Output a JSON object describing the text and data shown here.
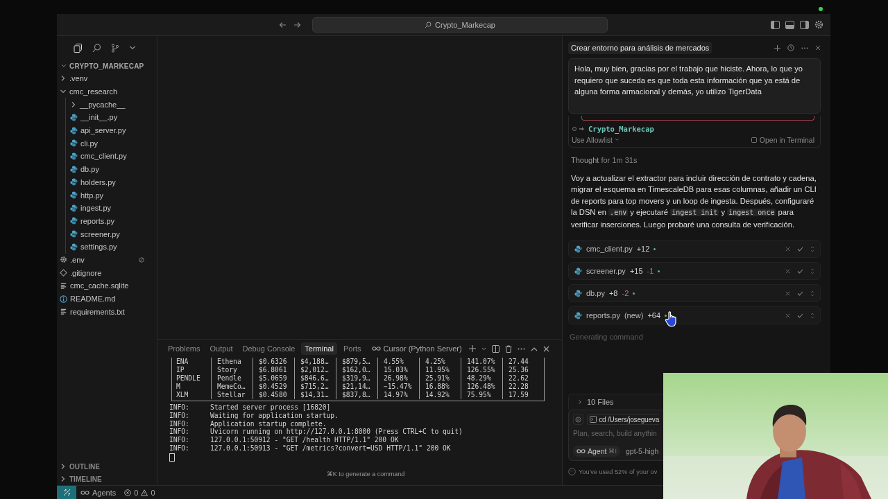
{
  "title_bar": {
    "search": "Crypto_Markecap"
  },
  "sidebar": {
    "project": "CRYPTO_MARKECAP",
    "tree": [
      {
        "name": ".venv",
        "kind": "folder",
        "expanded": false
      },
      {
        "name": "cmc_research",
        "kind": "folder",
        "expanded": true,
        "children": [
          {
            "name": "__pycache__",
            "kind": "folder",
            "expanded": false
          },
          {
            "name": "__init__.py",
            "kind": "python"
          },
          {
            "name": "api_server.py",
            "kind": "python"
          },
          {
            "name": "cli.py",
            "kind": "python"
          },
          {
            "name": "cmc_client.py",
            "kind": "python"
          },
          {
            "name": "db.py",
            "kind": "python"
          },
          {
            "name": "holders.py",
            "kind": "python"
          },
          {
            "name": "http.py",
            "kind": "python"
          },
          {
            "name": "ingest.py",
            "kind": "python"
          },
          {
            "name": "reports.py",
            "kind": "python"
          },
          {
            "name": "screener.py",
            "kind": "python"
          },
          {
            "name": "settings.py",
            "kind": "python"
          }
        ]
      },
      {
        "name": ".env",
        "kind": "settings",
        "ignored": true
      },
      {
        "name": ".gitignore",
        "kind": "git",
        "ignored": false
      },
      {
        "name": "cmc_cache.sqlite",
        "kind": "text",
        "ignored": false
      },
      {
        "name": "README.md",
        "kind": "info",
        "ignored": false
      },
      {
        "name": "requirements.txt",
        "kind": "text",
        "ignored": false
      }
    ],
    "sections": [
      {
        "label": "OUTLINE",
        "expanded": false
      },
      {
        "label": "TIMELINE",
        "expanded": false
      }
    ]
  },
  "panel": {
    "tabs": [
      {
        "label": "Problems",
        "selected": false
      },
      {
        "label": "Output",
        "selected": false
      },
      {
        "label": "Debug Console",
        "selected": false
      },
      {
        "label": "Terminal",
        "selected": true
      },
      {
        "label": "Ports",
        "selected": false
      }
    ],
    "terminal_name": "Cursor (Python Server)",
    "table_rows": [
      [
        "ENA",
        "Ethena",
        "$0.6326",
        "$4,188…",
        "$879,5…",
        "4.55%",
        "4.25%",
        "141.07%",
        "27.44"
      ],
      [
        "IP",
        "Story",
        "$6.8061",
        "$2,012…",
        "$162,0…",
        "15.03%",
        "11.95%",
        "126.55%",
        "25.36"
      ],
      [
        "PENDLE",
        "Pendle",
        "$5.0659",
        "$846,6…",
        "$319,9…",
        "26.98%",
        "25.91%",
        "48.29%",
        "22.62"
      ],
      [
        "M",
        "MemeCo…",
        "$0.4529",
        "$715,2…",
        "$21,14…",
        "−15.47%",
        "16.88%",
        "126.48%",
        "22.28"
      ],
      [
        "XLM",
        "Stellar",
        "$0.4580",
        "$14,31…",
        "$837,8…",
        "14.97%",
        "14.92%",
        "75.95%",
        "17.59"
      ]
    ],
    "log": [
      {
        "level": "INFO:",
        "message": "Started server process [16820]"
      },
      {
        "level": "INFO:",
        "message": "Waiting for application startup."
      },
      {
        "level": "INFO:",
        "message": "Application startup complete."
      },
      {
        "level": "INFO:",
        "message": "Uvicorn running on http://127.0.0.1:8000 (Press CTRL+C to quit)"
      },
      {
        "level": "INFO:",
        "message": "127.0.0.1:50912 - \"GET /health HTTP/1.1\" 200 OK"
      },
      {
        "level": "INFO:",
        "message": "127.0.0.1:50913 - \"GET /metrics?convert=USD HTTP/1.1\" 200 OK"
      }
    ],
    "hint": "⌘K to generate a command"
  },
  "chat": {
    "title": "Crear entorno para análisis de mercados",
    "user_message": "Hola, muy bien, gracias por el trabajo que hiciste. Ahora, lo que yo requiero que suceda es que toda esta información que ya está de alguna forma armacional y demás, yo utilizo TigerData",
    "command": {
      "path": "Crypto_Markecap",
      "allowlist": "Use Allowlist",
      "open": "Open in Terminal"
    },
    "thought": {
      "label": "Thought",
      "duration": "for 1m 31s"
    },
    "reply": [
      {
        "kind": "text",
        "text": "Voy a actualizar el extractor para incluir dirección de contrato y cadena, migrar el esquema en TimescaleDB para esas columnas, añadir un CLI de reports para top movers y un loop de ingesta. Después, configuraré la DSN en "
      },
      {
        "kind": "code",
        "text": ".env"
      },
      {
        "kind": "text",
        "text": " y ejecutaré "
      },
      {
        "kind": "code",
        "text": "ingest init"
      },
      {
        "kind": "text",
        "text": " y "
      },
      {
        "kind": "code",
        "text": "ingest once"
      },
      {
        "kind": "text",
        "text": " para verificar inserciones. Luego probaré una consulta de verificación."
      }
    ],
    "changes": [
      {
        "file": "cmc_client.py",
        "added": "+12"
      },
      {
        "file": "screener.py",
        "added": "+15",
        "removed": "-1"
      },
      {
        "file": "db.py",
        "added": "+8",
        "removed": "-2"
      },
      {
        "file": "reports.py",
        "tag": "(new)",
        "added": "+64"
      }
    ],
    "status": "Generating command",
    "files": "10 Files",
    "context_chip": "cd /Users/josegueva",
    "placeholder": "Plan, search, build anythin",
    "mode": "Agent",
    "mode_shortcut": "⌘I",
    "model": "gpt-5-high",
    "usage": "You've used 52% of your ov"
  },
  "status_bar": {
    "agents": "Agents",
    "errors": "0",
    "warnings": "0"
  }
}
